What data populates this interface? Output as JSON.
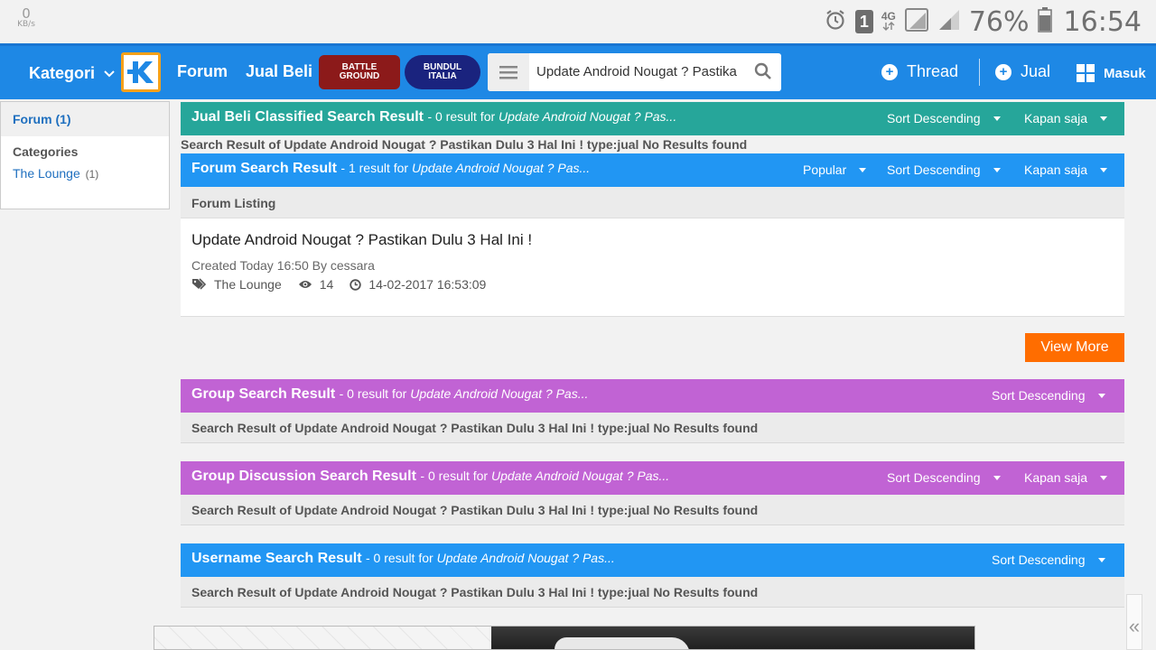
{
  "status_bar": {
    "net_speed_value": "0",
    "net_speed_unit": "KB/s",
    "sim": "1",
    "network": "4G",
    "battery": "76%",
    "time": "16:54"
  },
  "header": {
    "kategori": "Kategori",
    "forum": "Forum",
    "jual_beli": "Jual Beli",
    "battleground_top": "BATTLE",
    "battleground_bottom": "GROUND",
    "bundul_top": "BUNDUL",
    "bundul_bottom": "ITALIA",
    "search_value": "Update Android Nougat ? Pastika",
    "thread_button": "Thread",
    "jual_button": "Jual",
    "masuk_button": "Masuk"
  },
  "sidebar": {
    "forum_filter": "Forum (1)",
    "categories_heading": "Categories",
    "category_name": "The Lounge",
    "category_count": "(1)"
  },
  "results": {
    "jual_beli": {
      "title": "Jual Beli Classified Search Result",
      "meta": "- 0 result for ",
      "query": "Update Android Nougat ? Pas...",
      "sort": "Sort Descending",
      "time": "Kapan saja",
      "no_result": "Search Result of Update Android Nougat ? Pastikan Dulu 3 Hal Ini ! type:jual No Results found"
    },
    "forum": {
      "title": "Forum Search Result",
      "meta": "- 1 result for ",
      "query": "Update Android Nougat ? Pas...",
      "popular": "Popular",
      "sort": "Sort Descending",
      "time": "Kapan saja",
      "listing_heading": "Forum Listing",
      "thread_title": "Update Android Nougat ? Pastikan Dulu 3 Hal Ini !",
      "created": "Created Today 16:50 By cessara",
      "category": "The Lounge",
      "views": "14",
      "last_time": "14-02-2017 16:53:09",
      "view_more": "View More"
    },
    "group": {
      "title": "Group Search Result",
      "meta": "- 0 result for ",
      "query": "Update Android Nougat ? Pas...",
      "sort": "Sort Descending",
      "no_result": "Search Result of Update Android Nougat ? Pastikan Dulu 3 Hal Ini ! type:jual No Results found"
    },
    "group_discussion": {
      "title": "Group Discussion Search Result",
      "meta": "- 0 result for ",
      "query": "Update Android Nougat ? Pas...",
      "sort": "Sort Descending",
      "time": "Kapan saja",
      "no_result": "Search Result of Update Android Nougat ? Pastikan Dulu 3 Hal Ini ! type:jual No Results found"
    },
    "username": {
      "title": "Username Search Result",
      "meta": "- 0 result for ",
      "query": "Update Android Nougat ? Pas...",
      "sort": "Sort Descending",
      "no_result": "Search Result of Update Android Nougat ? Pastikan Dulu 3 Hal Ini ! type:jual No Results found"
    }
  },
  "collapse_symbol": "«",
  "colors": {
    "header": "#1e88e5",
    "teal": "#26a69a",
    "blue": "#2196f3",
    "purple": "#c163d4",
    "orange": "#ff6d00",
    "logo_border": "#f7a11a"
  }
}
